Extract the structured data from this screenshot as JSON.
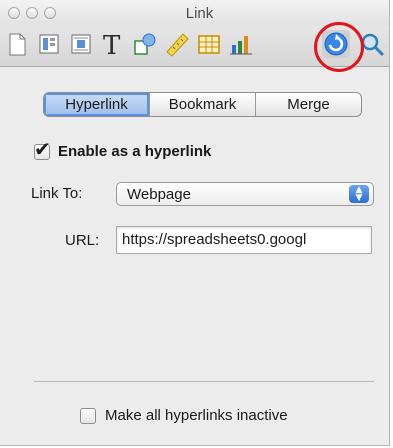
{
  "window": {
    "title": "Link"
  },
  "toolbar": {
    "icons": [
      "document-icon",
      "layout-icon",
      "wrap-icon",
      "text-icon",
      "shapes-icon",
      "ruler-icon",
      "table-icon",
      "chart-icon",
      "link-icon",
      "search-icon"
    ],
    "active": "link-icon"
  },
  "tabs": {
    "items": [
      "Hyperlink",
      "Bookmark",
      "Merge"
    ],
    "selected": "Hyperlink"
  },
  "enable": {
    "label": "Enable as a hyperlink",
    "checked": true
  },
  "link_to": {
    "label": "Link To:",
    "value": "Webpage"
  },
  "url": {
    "label": "URL:",
    "value": "https://spreadsheets0.googl"
  },
  "inactive": {
    "label": "Make all hyperlinks inactive",
    "checked": false
  },
  "colors": {
    "highlight": "#e3141b",
    "accent": "#2f6fd1"
  }
}
